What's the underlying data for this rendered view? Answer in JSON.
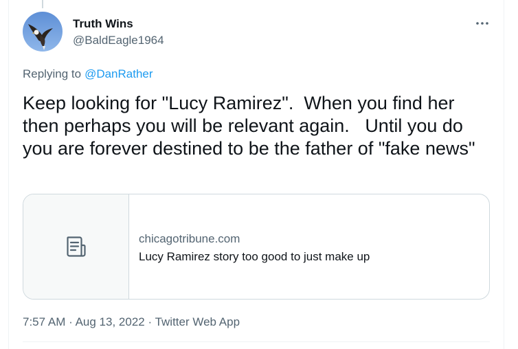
{
  "user": {
    "display_name": "Truth Wins",
    "handle": "@BaldEagle1964",
    "avatar_icon": "bald-eagle-avatar"
  },
  "more_icon": "more-horizontal-icon",
  "reply": {
    "prefix": "Replying to",
    "mention": "@DanRather"
  },
  "tweet": {
    "text": "Keep looking for \"Lucy Ramirez\".  When you find her then perhaps you will be relevant again.   Until you do you are forever destined to be the father of \"fake news\""
  },
  "card": {
    "domain": "chicagotribune.com",
    "title": "Lucy Ramirez story too good to just make up",
    "thumb_icon": "article-document-icon"
  },
  "meta": {
    "time": "7:57 AM",
    "separator1": "·",
    "date": "Aug 13, 2022",
    "separator2": "·",
    "source": "Twitter Web App"
  },
  "colors": {
    "text": "#0f1419",
    "secondary": "#536471",
    "link": "#1d9bf0",
    "border": "#cfd9de",
    "card_thumb_bg": "#f7f9f9"
  }
}
